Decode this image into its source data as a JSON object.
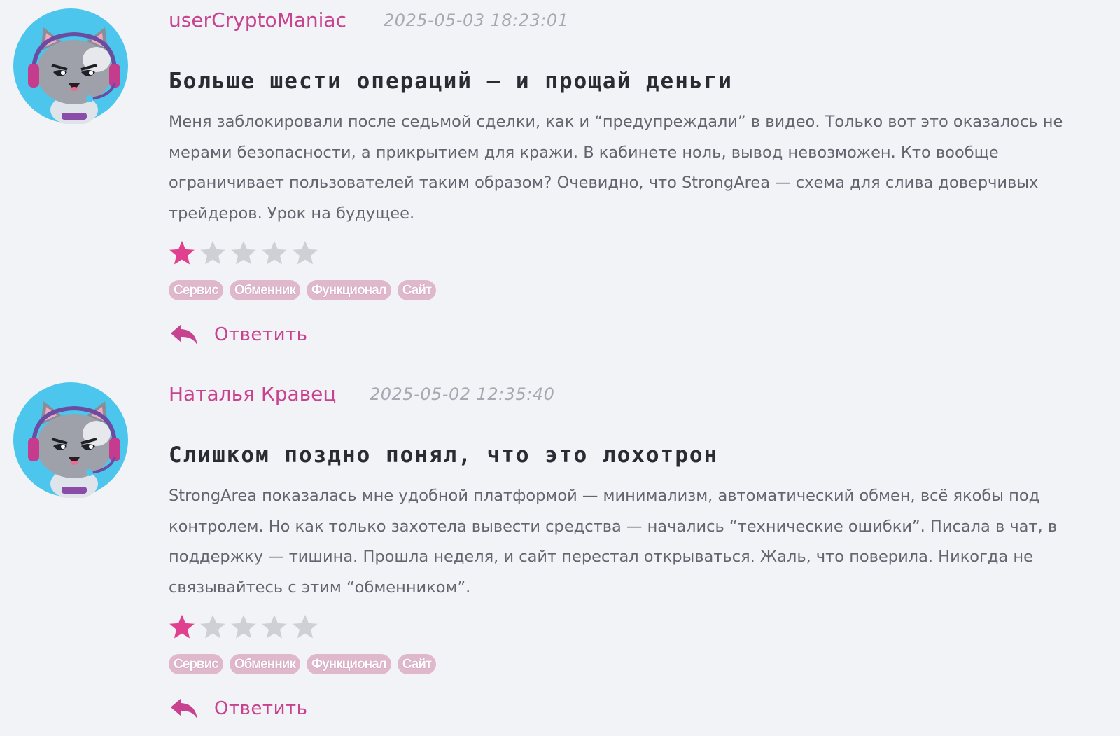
{
  "reviews": [
    {
      "author": "userCryptoManiac",
      "date": "2025-05-03 18:23:01",
      "title": "Больше шести операций — и прощай деньги",
      "body": "Меня заблокировали после седьмой сделки, как и “предупреждали” в видео. Только вот это оказалось не мерами безопасности, а прикрытием для кражи. В кабинете ноль, вывод невозможен. Кто вообще ограничивает пользователей таким образом? Очевидно, что StrongArea — схема для слива доверчивых трейдеров. Урок на будущее.",
      "rating": 1,
      "rating_max": 5,
      "tags": [
        "Сервис",
        "Обменник",
        "Функционал",
        "Сайт"
      ],
      "reply_label": "Ответить"
    },
    {
      "author": "Наталья Кравец",
      "date": "2025-05-02 12:35:40",
      "title": "Слишком поздно понял, что это лохотрон",
      "body": "StrongArea показалась мне удобной платформой — минимализм, автоматический обмен, всё якобы под контролем. Но как только захотела вывести средства — начались “технические ошибки”. Писала в чат, в поддержку — тишина. Прошла неделя, и сайт перестал открываться. Жаль, что поверила. Никогда не связывайтесь с этим “обменником”.",
      "rating": 1,
      "rating_max": 5,
      "tags": [
        "Сервис",
        "Обменник",
        "Функционал",
        "Сайт"
      ],
      "reply_label": "Ответить"
    }
  ],
  "colors": {
    "accent": "#c8438f",
    "star_filled": "#e0418f",
    "star_empty": "#cfcfd6",
    "tag_bg": "#dfb8cc",
    "background": "#f2f3f7"
  },
  "icons": {
    "avatar": "cat-gamer-avatar-icon",
    "star": "star-icon",
    "reply": "reply-arrow-icon"
  }
}
